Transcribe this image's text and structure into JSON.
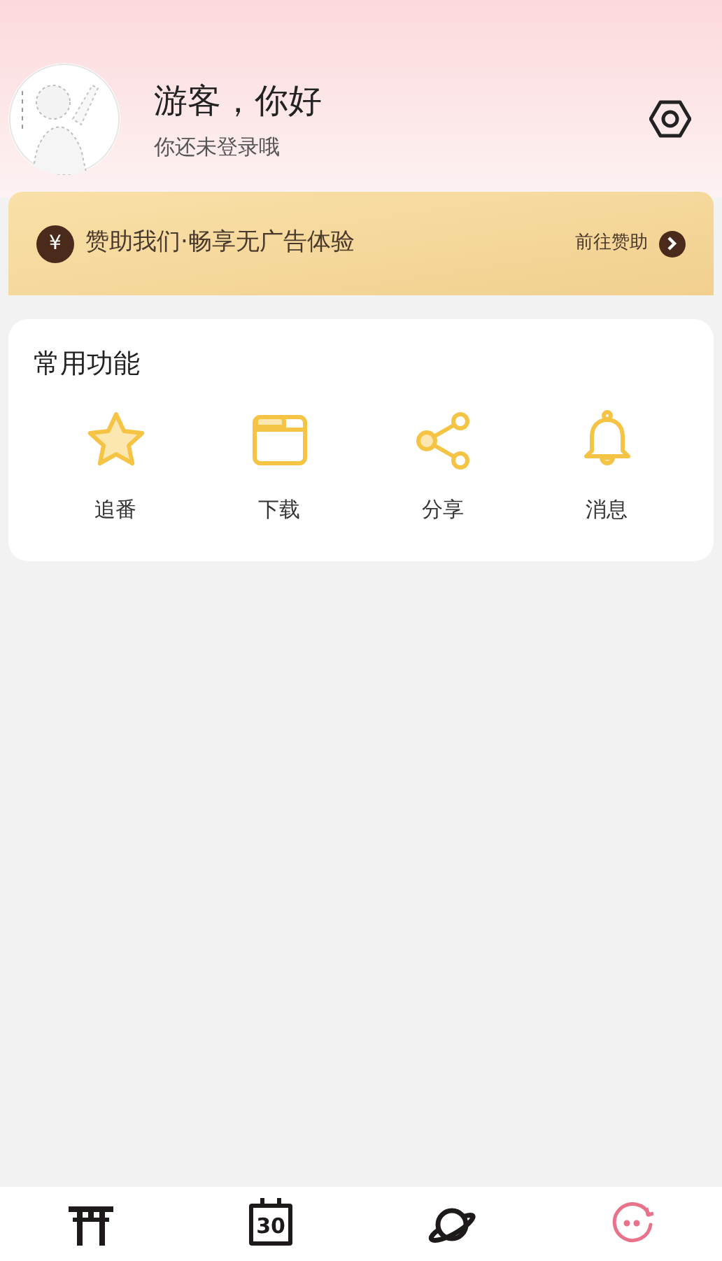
{
  "profile": {
    "greeting": "游客，你好",
    "subtitle": "你还未登录哦"
  },
  "sponsor_banner": {
    "icon": "¥",
    "text": "赞助我们·畅享无广告体验",
    "action": "前往赞助"
  },
  "common_functions": {
    "title": "常用功能",
    "items": [
      {
        "kind": "star",
        "label": "追番"
      },
      {
        "kind": "folder",
        "label": "下载"
      },
      {
        "kind": "share",
        "label": "分享"
      },
      {
        "kind": "bell",
        "label": "消息"
      }
    ]
  },
  "bottom_nav": [
    {
      "kind": "torii",
      "selected": false
    },
    {
      "kind": "calendar",
      "glyph": "30",
      "selected": false
    },
    {
      "kind": "planet",
      "selected": false
    },
    {
      "kind": "face",
      "selected": true
    }
  ]
}
